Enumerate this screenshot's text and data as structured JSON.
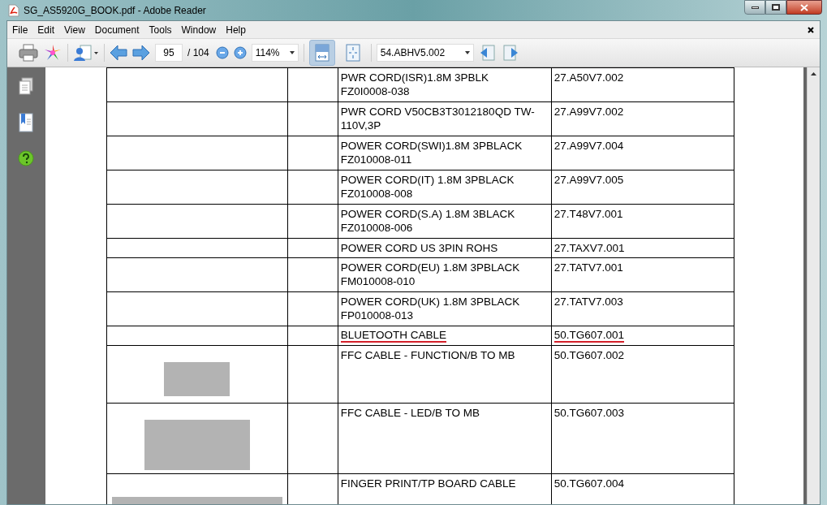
{
  "window": {
    "title": "SG_AS5920G_BOOK.pdf - Adobe Reader"
  },
  "menu": [
    "File",
    "Edit",
    "View",
    "Document",
    "Tools",
    "Window",
    "Help"
  ],
  "toolbar": {
    "page": "95",
    "page_count": "/ 104",
    "zoom": "114%",
    "fit_width_selected": true,
    "fit_page_selected": false,
    "search": "54.ABHV5.002"
  },
  "table": {
    "rows": [
      {
        "kind": "text",
        "description": [
          "PWR CORD(ISR)1.8M 3PBLK",
          "FZ0I0008-038"
        ],
        "part_no": "27.A50V7.002",
        "underlined": false
      },
      {
        "kind": "text",
        "description": [
          "PWR CORD V50CB3T3012180QD TW-",
          "110V,3P"
        ],
        "part_no": "27.A99V7.002",
        "underlined": false
      },
      {
        "kind": "text",
        "description": [
          "POWER CORD(SWI)1.8M 3PBLACK",
          "FZ010008-011"
        ],
        "part_no": "27.A99V7.004",
        "underlined": false
      },
      {
        "kind": "text",
        "description": [
          "POWER CORD(IT) 1.8M 3PBLACK",
          "FZ010008-008"
        ],
        "part_no": "27.A99V7.005",
        "underlined": false
      },
      {
        "kind": "text",
        "description": [
          "POWER CORD(S.A) 1.8M 3BLACK",
          "FZ010008-006"
        ],
        "part_no": "27.T48V7.001",
        "underlined": false
      },
      {
        "kind": "text",
        "description": [
          "POWER CORD US 3PIN ROHS"
        ],
        "part_no": "27.TAXV7.001",
        "underlined": false
      },
      {
        "kind": "text",
        "description": [
          "POWER CORD(EU) 1.8M 3PBLACK",
          "FM010008-010"
        ],
        "part_no": "27.TATV7.001",
        "underlined": false
      },
      {
        "kind": "text",
        "description": [
          "POWER CORD(UK) 1.8M 3PBLACK",
          "FP010008-013"
        ],
        "part_no": "27.TATV7.003",
        "underlined": false
      },
      {
        "kind": "text",
        "description": [
          "BLUETOOTH CABLE"
        ],
        "part_no": "50.TG607.001",
        "underlined": true
      },
      {
        "description": [
          "FFC CABLE - FUNCTION/B TO MB"
        ],
        "part_no": "50.TG607.002",
        "underlined": false
      },
      {
        "description": [
          "FFC CABLE - LED/B TO MB"
        ],
        "part_no": "50.TG607.003",
        "underlined": false
      },
      {
        "description": [
          "FINGER PRINT/TP BOARD CABLE"
        ],
        "part_no": "50.TG607.004",
        "underlined": false
      }
    ]
  }
}
